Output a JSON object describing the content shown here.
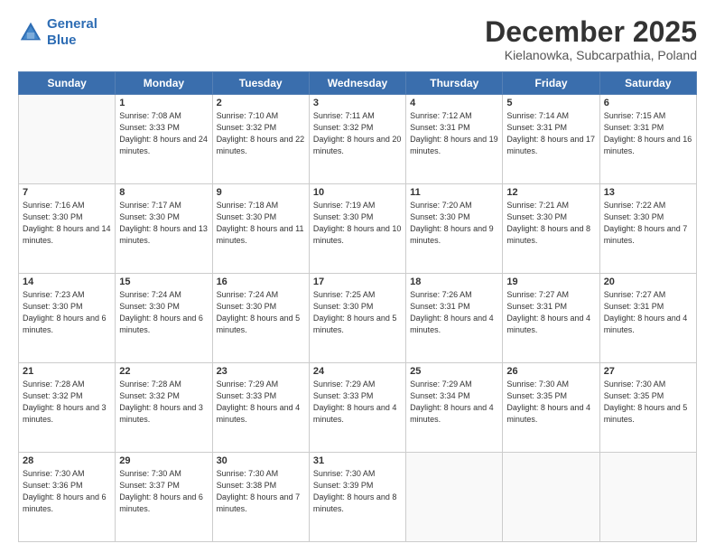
{
  "logo": {
    "line1": "General",
    "line2": "Blue"
  },
  "title": "December 2025",
  "location": "Kielanowka, Subcarpathia, Poland",
  "days_header": [
    "Sunday",
    "Monday",
    "Tuesday",
    "Wednesday",
    "Thursday",
    "Friday",
    "Saturday"
  ],
  "weeks": [
    [
      {
        "day": "",
        "sunrise": "",
        "sunset": "",
        "daylight": ""
      },
      {
        "day": "1",
        "sunrise": "Sunrise: 7:08 AM",
        "sunset": "Sunset: 3:33 PM",
        "daylight": "Daylight: 8 hours and 24 minutes."
      },
      {
        "day": "2",
        "sunrise": "Sunrise: 7:10 AM",
        "sunset": "Sunset: 3:32 PM",
        "daylight": "Daylight: 8 hours and 22 minutes."
      },
      {
        "day": "3",
        "sunrise": "Sunrise: 7:11 AM",
        "sunset": "Sunset: 3:32 PM",
        "daylight": "Daylight: 8 hours and 20 minutes."
      },
      {
        "day": "4",
        "sunrise": "Sunrise: 7:12 AM",
        "sunset": "Sunset: 3:31 PM",
        "daylight": "Daylight: 8 hours and 19 minutes."
      },
      {
        "day": "5",
        "sunrise": "Sunrise: 7:14 AM",
        "sunset": "Sunset: 3:31 PM",
        "daylight": "Daylight: 8 hours and 17 minutes."
      },
      {
        "day": "6",
        "sunrise": "Sunrise: 7:15 AM",
        "sunset": "Sunset: 3:31 PM",
        "daylight": "Daylight: 8 hours and 16 minutes."
      }
    ],
    [
      {
        "day": "7",
        "sunrise": "Sunrise: 7:16 AM",
        "sunset": "Sunset: 3:30 PM",
        "daylight": "Daylight: 8 hours and 14 minutes."
      },
      {
        "day": "8",
        "sunrise": "Sunrise: 7:17 AM",
        "sunset": "Sunset: 3:30 PM",
        "daylight": "Daylight: 8 hours and 13 minutes."
      },
      {
        "day": "9",
        "sunrise": "Sunrise: 7:18 AM",
        "sunset": "Sunset: 3:30 PM",
        "daylight": "Daylight: 8 hours and 11 minutes."
      },
      {
        "day": "10",
        "sunrise": "Sunrise: 7:19 AM",
        "sunset": "Sunset: 3:30 PM",
        "daylight": "Daylight: 8 hours and 10 minutes."
      },
      {
        "day": "11",
        "sunrise": "Sunrise: 7:20 AM",
        "sunset": "Sunset: 3:30 PM",
        "daylight": "Daylight: 8 hours and 9 minutes."
      },
      {
        "day": "12",
        "sunrise": "Sunrise: 7:21 AM",
        "sunset": "Sunset: 3:30 PM",
        "daylight": "Daylight: 8 hours and 8 minutes."
      },
      {
        "day": "13",
        "sunrise": "Sunrise: 7:22 AM",
        "sunset": "Sunset: 3:30 PM",
        "daylight": "Daylight: 8 hours and 7 minutes."
      }
    ],
    [
      {
        "day": "14",
        "sunrise": "Sunrise: 7:23 AM",
        "sunset": "Sunset: 3:30 PM",
        "daylight": "Daylight: 8 hours and 6 minutes."
      },
      {
        "day": "15",
        "sunrise": "Sunrise: 7:24 AM",
        "sunset": "Sunset: 3:30 PM",
        "daylight": "Daylight: 8 hours and 6 minutes."
      },
      {
        "day": "16",
        "sunrise": "Sunrise: 7:24 AM",
        "sunset": "Sunset: 3:30 PM",
        "daylight": "Daylight: 8 hours and 5 minutes."
      },
      {
        "day": "17",
        "sunrise": "Sunrise: 7:25 AM",
        "sunset": "Sunset: 3:30 PM",
        "daylight": "Daylight: 8 hours and 5 minutes."
      },
      {
        "day": "18",
        "sunrise": "Sunrise: 7:26 AM",
        "sunset": "Sunset: 3:31 PM",
        "daylight": "Daylight: 8 hours and 4 minutes."
      },
      {
        "day": "19",
        "sunrise": "Sunrise: 7:27 AM",
        "sunset": "Sunset: 3:31 PM",
        "daylight": "Daylight: 8 hours and 4 minutes."
      },
      {
        "day": "20",
        "sunrise": "Sunrise: 7:27 AM",
        "sunset": "Sunset: 3:31 PM",
        "daylight": "Daylight: 8 hours and 4 minutes."
      }
    ],
    [
      {
        "day": "21",
        "sunrise": "Sunrise: 7:28 AM",
        "sunset": "Sunset: 3:32 PM",
        "daylight": "Daylight: 8 hours and 3 minutes."
      },
      {
        "day": "22",
        "sunrise": "Sunrise: 7:28 AM",
        "sunset": "Sunset: 3:32 PM",
        "daylight": "Daylight: 8 hours and 3 minutes."
      },
      {
        "day": "23",
        "sunrise": "Sunrise: 7:29 AM",
        "sunset": "Sunset: 3:33 PM",
        "daylight": "Daylight: 8 hours and 4 minutes."
      },
      {
        "day": "24",
        "sunrise": "Sunrise: 7:29 AM",
        "sunset": "Sunset: 3:33 PM",
        "daylight": "Daylight: 8 hours and 4 minutes."
      },
      {
        "day": "25",
        "sunrise": "Sunrise: 7:29 AM",
        "sunset": "Sunset: 3:34 PM",
        "daylight": "Daylight: 8 hours and 4 minutes."
      },
      {
        "day": "26",
        "sunrise": "Sunrise: 7:30 AM",
        "sunset": "Sunset: 3:35 PM",
        "daylight": "Daylight: 8 hours and 4 minutes."
      },
      {
        "day": "27",
        "sunrise": "Sunrise: 7:30 AM",
        "sunset": "Sunset: 3:35 PM",
        "daylight": "Daylight: 8 hours and 5 minutes."
      }
    ],
    [
      {
        "day": "28",
        "sunrise": "Sunrise: 7:30 AM",
        "sunset": "Sunset: 3:36 PM",
        "daylight": "Daylight: 8 hours and 6 minutes."
      },
      {
        "day": "29",
        "sunrise": "Sunrise: 7:30 AM",
        "sunset": "Sunset: 3:37 PM",
        "daylight": "Daylight: 8 hours and 6 minutes."
      },
      {
        "day": "30",
        "sunrise": "Sunrise: 7:30 AM",
        "sunset": "Sunset: 3:38 PM",
        "daylight": "Daylight: 8 hours and 7 minutes."
      },
      {
        "day": "31",
        "sunrise": "Sunrise: 7:30 AM",
        "sunset": "Sunset: 3:39 PM",
        "daylight": "Daylight: 8 hours and 8 minutes."
      },
      {
        "day": "",
        "sunrise": "",
        "sunset": "",
        "daylight": ""
      },
      {
        "day": "",
        "sunrise": "",
        "sunset": "",
        "daylight": ""
      },
      {
        "day": "",
        "sunrise": "",
        "sunset": "",
        "daylight": ""
      }
    ]
  ]
}
